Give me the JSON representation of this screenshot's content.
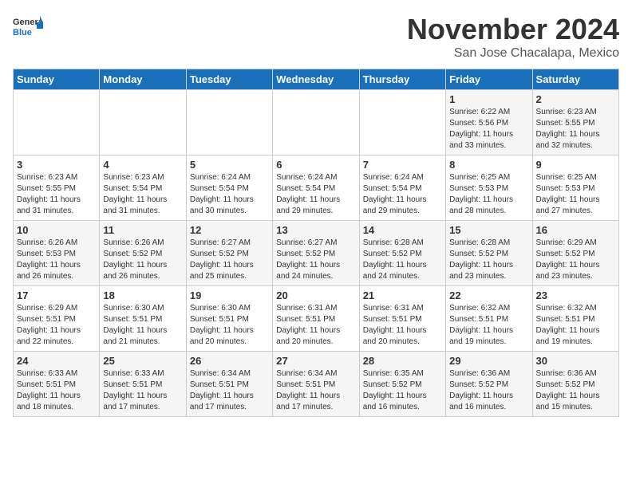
{
  "header": {
    "logo_line1": "General",
    "logo_line2": "Blue",
    "month": "November 2024",
    "location": "San Jose Chacalapa, Mexico"
  },
  "days_of_week": [
    "Sunday",
    "Monday",
    "Tuesday",
    "Wednesday",
    "Thursday",
    "Friday",
    "Saturday"
  ],
  "weeks": [
    [
      {
        "day": "",
        "info": ""
      },
      {
        "day": "",
        "info": ""
      },
      {
        "day": "",
        "info": ""
      },
      {
        "day": "",
        "info": ""
      },
      {
        "day": "",
        "info": ""
      },
      {
        "day": "1",
        "info": "Sunrise: 6:22 AM\nSunset: 5:56 PM\nDaylight: 11 hours\nand 33 minutes."
      },
      {
        "day": "2",
        "info": "Sunrise: 6:23 AM\nSunset: 5:55 PM\nDaylight: 11 hours\nand 32 minutes."
      }
    ],
    [
      {
        "day": "3",
        "info": "Sunrise: 6:23 AM\nSunset: 5:55 PM\nDaylight: 11 hours\nand 31 minutes."
      },
      {
        "day": "4",
        "info": "Sunrise: 6:23 AM\nSunset: 5:54 PM\nDaylight: 11 hours\nand 31 minutes."
      },
      {
        "day": "5",
        "info": "Sunrise: 6:24 AM\nSunset: 5:54 PM\nDaylight: 11 hours\nand 30 minutes."
      },
      {
        "day": "6",
        "info": "Sunrise: 6:24 AM\nSunset: 5:54 PM\nDaylight: 11 hours\nand 29 minutes."
      },
      {
        "day": "7",
        "info": "Sunrise: 6:24 AM\nSunset: 5:54 PM\nDaylight: 11 hours\nand 29 minutes."
      },
      {
        "day": "8",
        "info": "Sunrise: 6:25 AM\nSunset: 5:53 PM\nDaylight: 11 hours\nand 28 minutes."
      },
      {
        "day": "9",
        "info": "Sunrise: 6:25 AM\nSunset: 5:53 PM\nDaylight: 11 hours\nand 27 minutes."
      }
    ],
    [
      {
        "day": "10",
        "info": "Sunrise: 6:26 AM\nSunset: 5:53 PM\nDaylight: 11 hours\nand 26 minutes."
      },
      {
        "day": "11",
        "info": "Sunrise: 6:26 AM\nSunset: 5:52 PM\nDaylight: 11 hours\nand 26 minutes."
      },
      {
        "day": "12",
        "info": "Sunrise: 6:27 AM\nSunset: 5:52 PM\nDaylight: 11 hours\nand 25 minutes."
      },
      {
        "day": "13",
        "info": "Sunrise: 6:27 AM\nSunset: 5:52 PM\nDaylight: 11 hours\nand 24 minutes."
      },
      {
        "day": "14",
        "info": "Sunrise: 6:28 AM\nSunset: 5:52 PM\nDaylight: 11 hours\nand 24 minutes."
      },
      {
        "day": "15",
        "info": "Sunrise: 6:28 AM\nSunset: 5:52 PM\nDaylight: 11 hours\nand 23 minutes."
      },
      {
        "day": "16",
        "info": "Sunrise: 6:29 AM\nSunset: 5:52 PM\nDaylight: 11 hours\nand 23 minutes."
      }
    ],
    [
      {
        "day": "17",
        "info": "Sunrise: 6:29 AM\nSunset: 5:51 PM\nDaylight: 11 hours\nand 22 minutes."
      },
      {
        "day": "18",
        "info": "Sunrise: 6:30 AM\nSunset: 5:51 PM\nDaylight: 11 hours\nand 21 minutes."
      },
      {
        "day": "19",
        "info": "Sunrise: 6:30 AM\nSunset: 5:51 PM\nDaylight: 11 hours\nand 20 minutes."
      },
      {
        "day": "20",
        "info": "Sunrise: 6:31 AM\nSunset: 5:51 PM\nDaylight: 11 hours\nand 20 minutes."
      },
      {
        "day": "21",
        "info": "Sunrise: 6:31 AM\nSunset: 5:51 PM\nDaylight: 11 hours\nand 20 minutes."
      },
      {
        "day": "22",
        "info": "Sunrise: 6:32 AM\nSunset: 5:51 PM\nDaylight: 11 hours\nand 19 minutes."
      },
      {
        "day": "23",
        "info": "Sunrise: 6:32 AM\nSunset: 5:51 PM\nDaylight: 11 hours\nand 19 minutes."
      }
    ],
    [
      {
        "day": "24",
        "info": "Sunrise: 6:33 AM\nSunset: 5:51 PM\nDaylight: 11 hours\nand 18 minutes."
      },
      {
        "day": "25",
        "info": "Sunrise: 6:33 AM\nSunset: 5:51 PM\nDaylight: 11 hours\nand 17 minutes."
      },
      {
        "day": "26",
        "info": "Sunrise: 6:34 AM\nSunset: 5:51 PM\nDaylight: 11 hours\nand 17 minutes."
      },
      {
        "day": "27",
        "info": "Sunrise: 6:34 AM\nSunset: 5:51 PM\nDaylight: 11 hours\nand 17 minutes."
      },
      {
        "day": "28",
        "info": "Sunrise: 6:35 AM\nSunset: 5:52 PM\nDaylight: 11 hours\nand 16 minutes."
      },
      {
        "day": "29",
        "info": "Sunrise: 6:36 AM\nSunset: 5:52 PM\nDaylight: 11 hours\nand 16 minutes."
      },
      {
        "day": "30",
        "info": "Sunrise: 6:36 AM\nSunset: 5:52 PM\nDaylight: 11 hours\nand 15 minutes."
      }
    ]
  ]
}
